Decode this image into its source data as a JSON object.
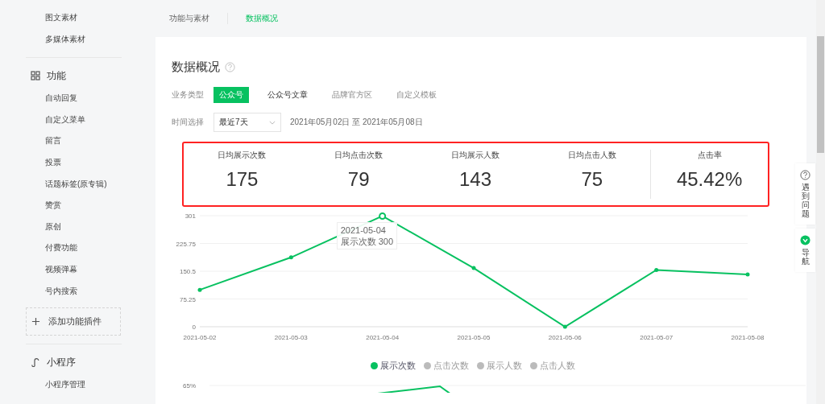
{
  "sidebar": {
    "sections": [
      {
        "items": [
          "图文素材",
          "多媒体素材"
        ]
      },
      {
        "heading": "功能",
        "items": [
          "自动回复",
          "自定义菜单",
          "留言",
          "投票",
          "话题标签(原专辑)",
          "赞赏",
          "原创",
          "付费功能",
          "视频弹幕",
          "号内搜索"
        ],
        "add_button": "添加功能插件"
      },
      {
        "heading": "小程序",
        "items": [
          "小程序管理"
        ]
      }
    ]
  },
  "top_tabs": [
    {
      "label": "功能与素材",
      "selected": false
    },
    {
      "label": "数据概况",
      "selected": true
    }
  ],
  "card": {
    "title": "数据概况",
    "business_type": {
      "label": "业务类型",
      "options": [
        {
          "label": "公众号",
          "selected": true,
          "hovered": false
        },
        {
          "label": "公众号文章",
          "selected": false,
          "hovered": true
        },
        {
          "label": "品牌官方区",
          "selected": false,
          "hovered": false
        },
        {
          "label": "自定义模板",
          "selected": false,
          "hovered": false
        }
      ]
    },
    "time": {
      "label": "时间选择",
      "value": "最近7天",
      "range": "2021年05月02日 至 2021年05月08日"
    },
    "metrics": [
      {
        "label": "日均展示次数",
        "value": "175",
        "separated": false
      },
      {
        "label": "日均点击次数",
        "value": "79",
        "separated": false
      },
      {
        "label": "日均展示人数",
        "value": "143",
        "separated": false
      },
      {
        "label": "日均点击人数",
        "value": "75",
        "separated": false
      },
      {
        "label": "点击率",
        "value": "45.42%",
        "separated": true
      }
    ],
    "chart_data": {
      "type": "line",
      "categories": [
        "2021-05-02",
        "2021-05-03",
        "2021-05-04",
        "2021-05-05",
        "2021-05-06",
        "2021-05-07",
        "2021-05-08"
      ],
      "series": [
        {
          "name": "展示次数",
          "color": "#07c160",
          "values": [
            100,
            188,
            300,
            159,
            0,
            154,
            142
          ]
        }
      ],
      "ylim": [
        0,
        301
      ],
      "yticks": [
        0,
        75.25,
        150.5,
        225.75,
        301
      ],
      "grid": true
    },
    "tooltip": {
      "title": "2021-05-04",
      "text": "展示次数 300"
    },
    "legend": [
      {
        "label": "点击次数",
        "selected": false
      },
      {
        "label": "展示人数",
        "selected": false
      },
      {
        "label": "点击人数",
        "selected": false
      }
    ],
    "second_chart": {
      "ytick": "65%"
    }
  },
  "help_rail": [
    {
      "label": "遇到问题"
    },
    {
      "label": "导航"
    }
  ]
}
